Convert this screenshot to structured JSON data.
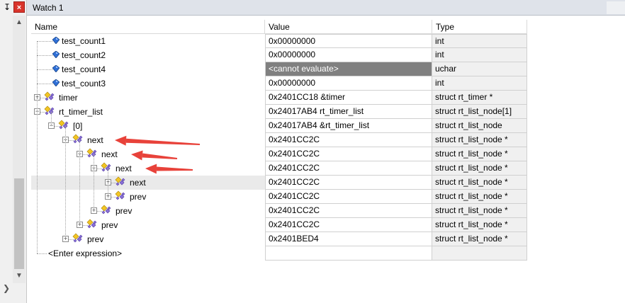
{
  "panel": {
    "title": "Watch 1",
    "pin_glyph": "↧",
    "close_glyph": "×"
  },
  "columns": {
    "name": "Name",
    "value": "Value",
    "type": "Type"
  },
  "rows": [
    {
      "name": "test_count1",
      "value": "0x00000000",
      "type": "int"
    },
    {
      "name": "test_count2",
      "value": "0x00000000",
      "type": "int"
    },
    {
      "name": "test_count4",
      "value": "<cannot evaluate>",
      "type": "uchar"
    },
    {
      "name": "test_count3",
      "value": "0x00000000",
      "type": "int"
    },
    {
      "name": "timer",
      "value": "0x2401CC18 &timer",
      "type": "struct rt_timer *"
    },
    {
      "name": "rt_timer_list",
      "value": "0x24017AB4 rt_timer_list",
      "type": "struct rt_list_node[1]"
    },
    {
      "name": "[0]",
      "value": "0x24017AB4 &rt_timer_list",
      "type": "struct rt_list_node"
    },
    {
      "name": "next",
      "value": "0x2401CC2C",
      "type": "struct rt_list_node *"
    },
    {
      "name": "next",
      "value": "0x2401CC2C",
      "type": "struct rt_list_node *"
    },
    {
      "name": "next",
      "value": "0x2401CC2C",
      "type": "struct rt_list_node *"
    },
    {
      "name": "next",
      "value": "0x2401CC2C",
      "type": "struct rt_list_node *"
    },
    {
      "name": "prev",
      "value": "0x2401CC2C",
      "type": "struct rt_list_node *"
    },
    {
      "name": "prev",
      "value": "0x2401CC2C",
      "type": "struct rt_list_node *"
    },
    {
      "name": "prev",
      "value": "0x2401CC2C",
      "type": "struct rt_list_node *"
    },
    {
      "name": "prev",
      "value": "0x2401BED4",
      "type": "struct rt_list_node *"
    }
  ],
  "enter_expression": "<Enter expression>",
  "colors": {
    "arrow": "#e8423a",
    "error_bg": "#808080",
    "icon_blue": "#1f5fc0"
  }
}
